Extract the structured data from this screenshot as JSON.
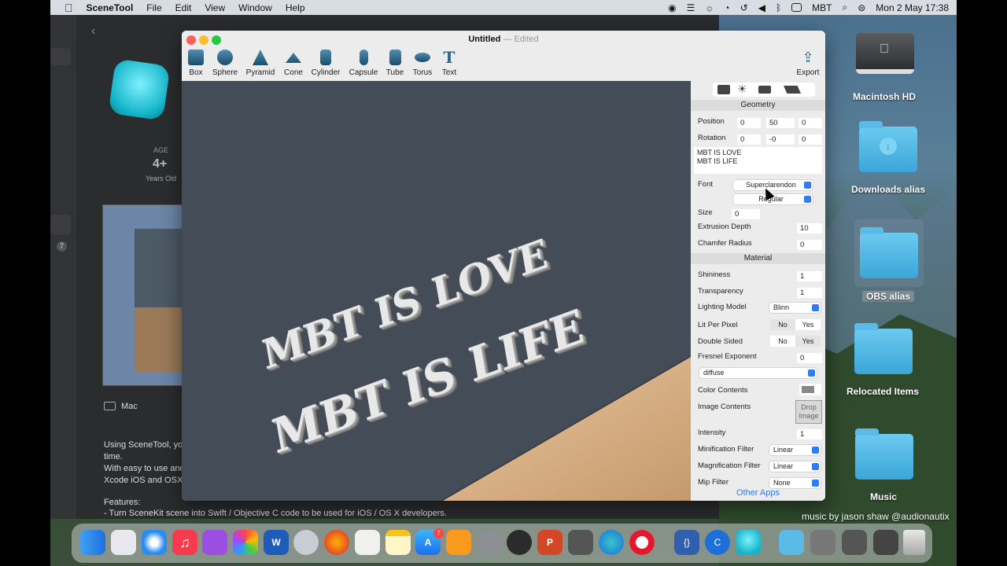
{
  "menubar": {
    "app_name": "SceneTool",
    "menus": [
      "File",
      "Edit",
      "View",
      "Window",
      "Help"
    ],
    "input_source": "MBT",
    "clock": "Mon 2 May  17:38"
  },
  "store": {
    "age_label": "AGE",
    "age_value": "4+",
    "age_sub": "Years Old",
    "platform": "Mac",
    "badge": "7",
    "description": [
      "Using SceneTool, you",
      "time.",
      "With easy to use and",
      "Xcode iOS and OSX"
    ],
    "features_title": "Features:",
    "feature1": "- Turn SceneKit scene into Swift / Objective C code to be used for iOS / OS X developers."
  },
  "window": {
    "title": "Untitled",
    "status": "Edited",
    "export_label": "Export",
    "tools": [
      "Box",
      "Sphere",
      "Pyramid",
      "Cone",
      "Cylinder",
      "Capsule",
      "Tube",
      "Torus",
      "Text"
    ],
    "scene_text": [
      "MBT IS LOVE",
      "MBT IS LIFE"
    ]
  },
  "inspector": {
    "geometry_title": "Geometry",
    "position_label": "Position",
    "position": [
      "0",
      "50",
      "0"
    ],
    "rotation_label": "Rotation",
    "rotation": [
      "0",
      "-0",
      "0"
    ],
    "text_lines": [
      "MBT IS LOVE",
      "MBT IS LIFE"
    ],
    "font_label": "Font",
    "font_family": "Superclarendon",
    "font_style": "Regular",
    "size_label": "Size",
    "size": "0",
    "extrusion_label": "Extrusion Depth",
    "extrusion": "10",
    "chamfer_label": "Chamfer Radius",
    "chamfer": "0",
    "material_title": "Material",
    "shininess_label": "Shininess",
    "shininess": "1",
    "transparency_label": "Transparency",
    "transparency": "1",
    "lighting_label": "Lighting Model",
    "lighting": "Blinn",
    "litperpixel_label": "Lit Per Pixel",
    "doublesided_label": "Double Sided",
    "no": "No",
    "yes": "Yes",
    "fresnel_label": "Fresnel Exponent",
    "fresnel": "0",
    "contents_type": "diffuse",
    "color_contents_label": "Color Contents",
    "image_contents_label": "Image Contents",
    "drop_image": "Drop Image",
    "intensity_label": "Intensity",
    "intensity": "1",
    "minification_label": "Minification Filter",
    "minification": "Linear",
    "magnification_label": "Magnification Filter",
    "magnification": "Linear",
    "mip_label": "Mip Filter",
    "mip": "None",
    "other_apps": "Other Apps"
  },
  "desktop": {
    "items": [
      "Macintosh HD",
      "Downloads alias",
      "OBS alias",
      "Relocated Items",
      "Music"
    ],
    "credit": "music by jason shaw @audionautix"
  },
  "dock": {
    "appstore_badge": "7"
  },
  "colors": {
    "accent": "#2f7cf6",
    "viewport_bg": "#444c57",
    "folder": "#4bb4e4"
  }
}
